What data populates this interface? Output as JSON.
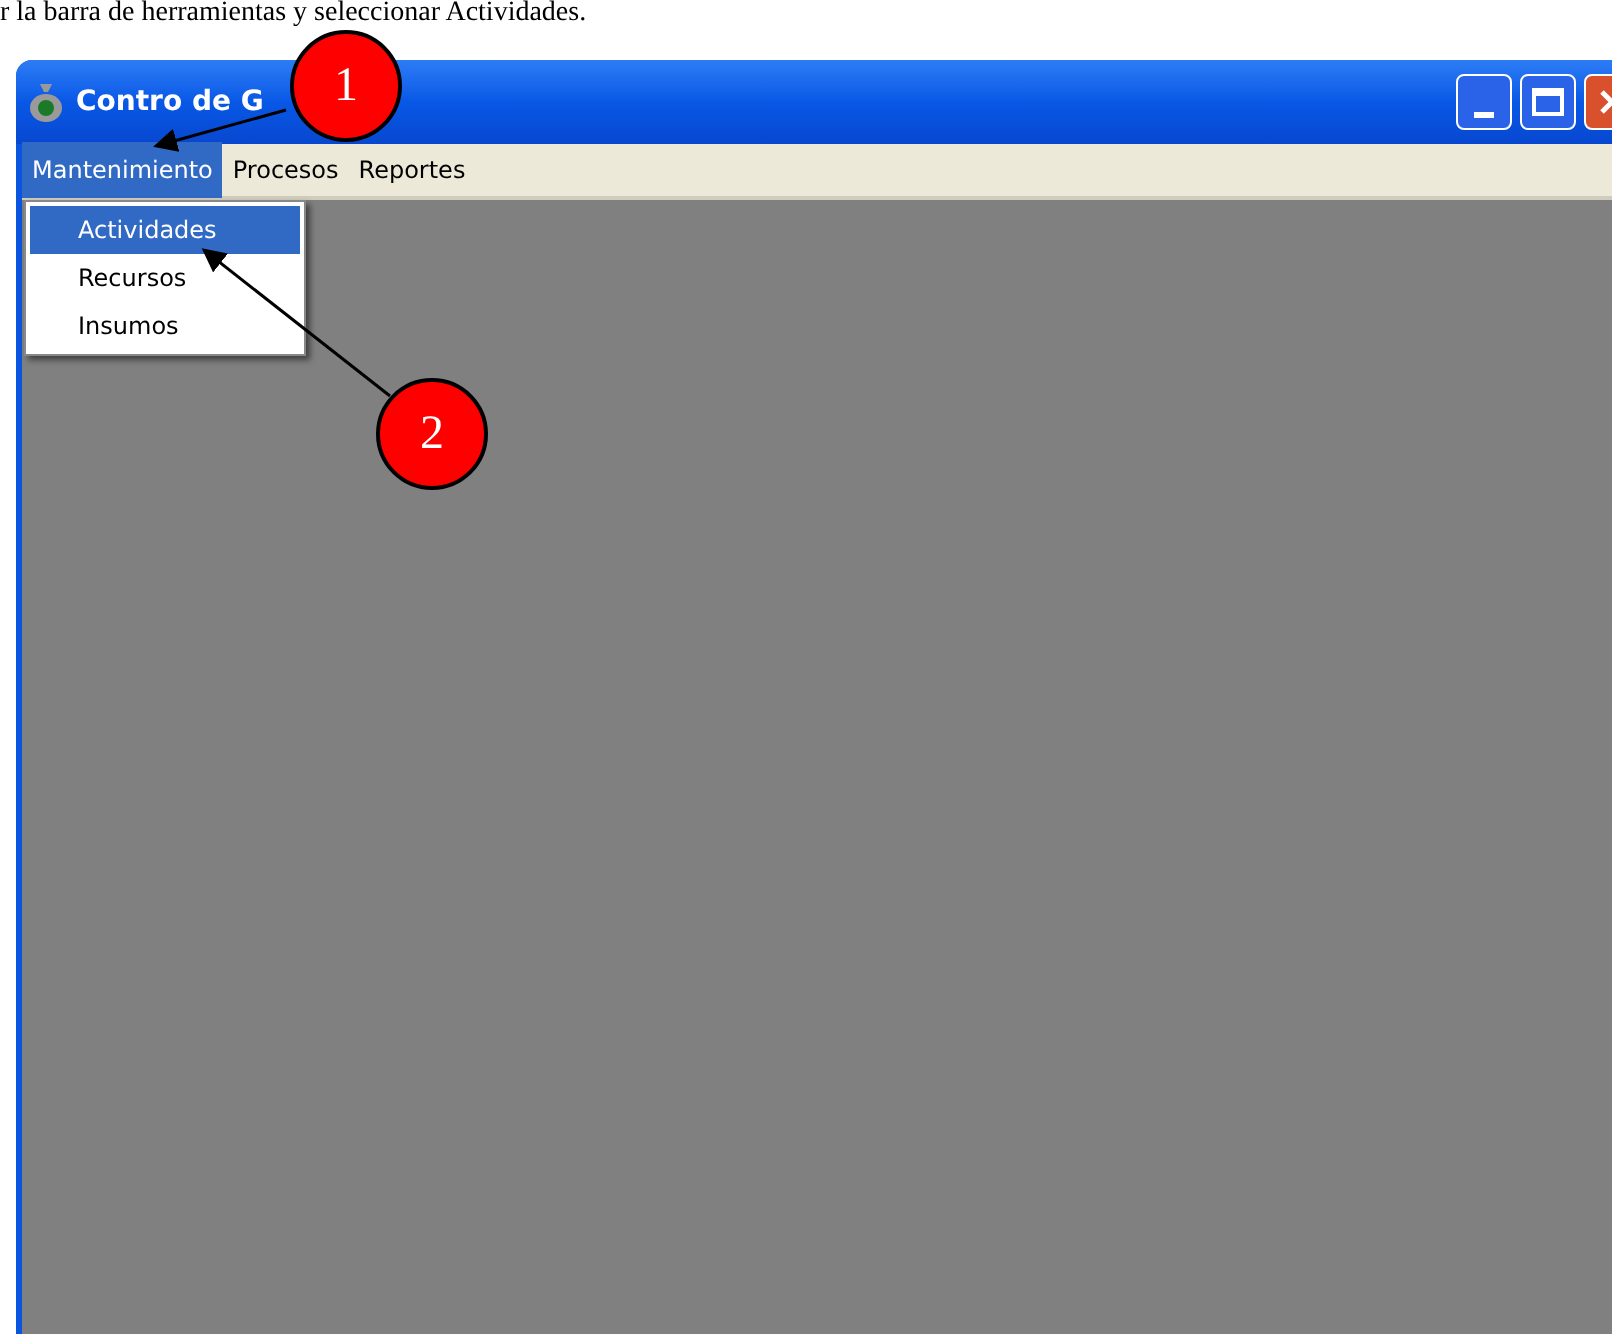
{
  "instruction": "r la barra de herramientas y seleccionar Actividades.",
  "window": {
    "title": "Contro de G"
  },
  "menu_bar": [
    {
      "label": "Mantenimiento",
      "selected": true
    },
    {
      "label": "Procesos",
      "selected": false
    },
    {
      "label": "Reportes",
      "selected": false
    }
  ],
  "dropdown": [
    {
      "label": "Actividades",
      "selected": true
    },
    {
      "label": "Recursos",
      "selected": false
    },
    {
      "label": "Insumos",
      "selected": false
    }
  ],
  "callouts": [
    "1",
    "2"
  ]
}
